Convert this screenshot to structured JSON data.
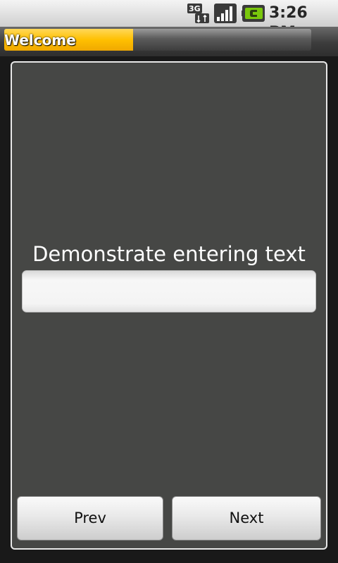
{
  "status_bar": {
    "network_label": "3G",
    "time": "3:26 PM",
    "icons": [
      "3g-data-icon",
      "signal-strength-icon",
      "battery-charging-icon"
    ]
  },
  "title_bar": {
    "title": "Welcome",
    "progress_fraction": 0.42
  },
  "main": {
    "prompt": "Demonstrate entering text",
    "text_field": {
      "value": "",
      "placeholder": ""
    }
  },
  "buttons": {
    "prev_label": "Prev",
    "next_label": "Next"
  },
  "colors": {
    "progress": "#ffc000",
    "panel_background": "#464745",
    "panel_border": "#e8e8e8",
    "battery": "#7ac70c"
  }
}
